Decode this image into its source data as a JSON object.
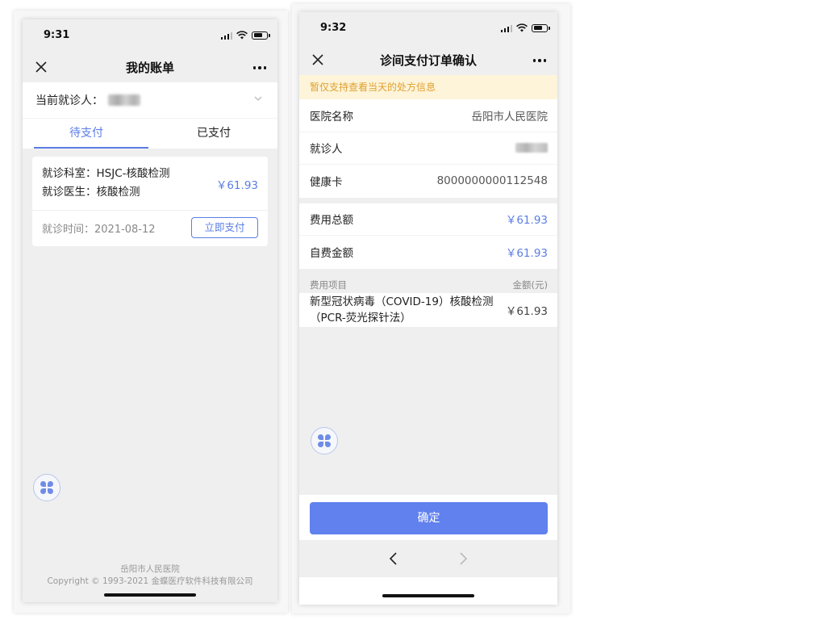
{
  "screen1": {
    "status_time": "9:31",
    "title": "我的账单",
    "patient_label": "当前就诊人：",
    "tabs": [
      {
        "label": "待支付",
        "active": true
      },
      {
        "label": "已支付",
        "active": false
      }
    ],
    "bill": {
      "department": "就诊科室：HSJC-核酸检测",
      "doctor": "就诊医生：核酸检测",
      "amount": "￥61.93",
      "time": "就诊时间：2021-08-12",
      "pay_label": "立即支付"
    },
    "footer_line1": "岳阳市人民医院",
    "footer_line2": "Copyright © 1993-2021 金蝶医疗软件科技有限公司"
  },
  "screen2": {
    "status_time": "9:32",
    "title": "诊间支付订单确认",
    "notice": "暂仅支持查看当天的处方信息",
    "info": [
      {
        "key": "医院名称",
        "value": "岳阳市人民医院"
      },
      {
        "key": "就诊人",
        "value": ""
      },
      {
        "key": "健康卡",
        "value": "8000000000112548"
      }
    ],
    "fees": [
      {
        "key": "费用总额",
        "value": "￥61.93"
      },
      {
        "key": "自费金额",
        "value": "￥61.93"
      }
    ],
    "items_header_left": "费用项目",
    "items_header_right": "金额(元)",
    "items": [
      {
        "name": "新型冠状病毒（COVID-19）核酸检测（PCR-荧光探针法）",
        "price": "￥61.93"
      }
    ],
    "confirm_label": "确定"
  },
  "colors": {
    "accent": "#5b7ee5",
    "button": "#6081ee",
    "notice_bg": "#fdf4d9",
    "notice_text": "#e0a030"
  }
}
